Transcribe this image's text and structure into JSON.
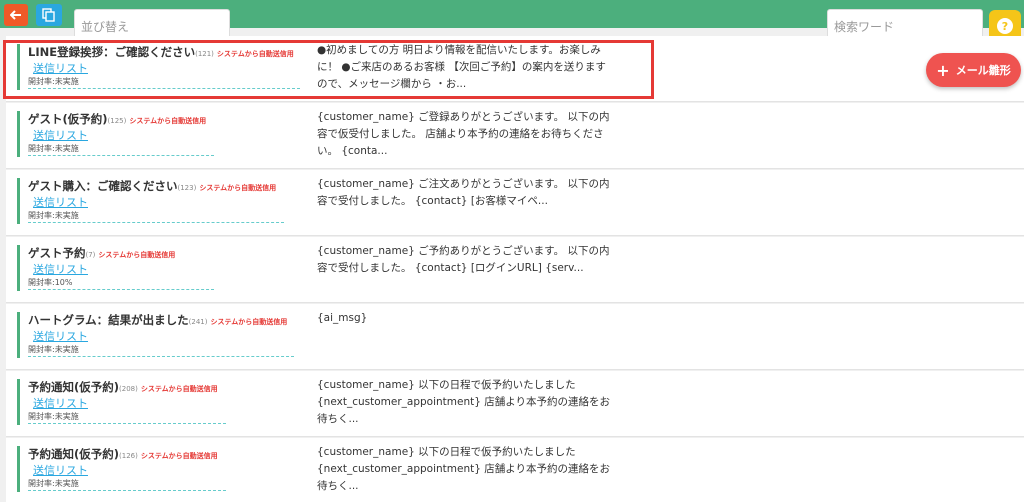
{
  "toolbar": {
    "sort_placeholder": "並び替え",
    "search_placeholder": "検索ワード",
    "new_mail_label": "メール雛形",
    "help_label": "?"
  },
  "rows": [
    {
      "title": "LINE登録挨拶：ご確認ください",
      "count": "(121)",
      "auto_label": "システムから自動送信用",
      "link": "送信リスト",
      "rate": "開封率:未実施",
      "message": "●初めましての方 明日より情報を配信いたします。お楽しみに！ ●ご来店のあるお客様 【次回ご予約】の案内を送りますので、メッセージ欄から ・お..."
    },
    {
      "title": "ゲスト(仮予約)",
      "count": "(125)",
      "auto_label": "システムから自動送信用",
      "link": "送信リスト",
      "rate": "開封率:未実施",
      "message": "{customer_name} ご登録ありがとうございます。 以下の内容で仮受付しました。 店舗より本予約の連絡をお待ちください。 {conta..."
    },
    {
      "title": "ゲスト購入：ご確認ください",
      "count": "(123)",
      "auto_label": "システムから自動送信用",
      "link": "送信リスト",
      "rate": "開封率:未実施",
      "message": "{customer_name} ご注文ありがとうございます。 以下の内容で受付しました。 {contact} [お客様マイペ..."
    },
    {
      "title": "ゲスト予約",
      "count": "(7)",
      "auto_label": "システムから自動送信用",
      "link": "送信リスト",
      "rate": "開封率:10%",
      "message": "{customer_name} ご予約ありがとうございます。 以下の内容で受付しました。 {contact} [ログインURL] {serv..."
    },
    {
      "title": "ハートグラム：結果が出ました",
      "count": "(241)",
      "auto_label": "システムから自動送信用",
      "link": "送信リスト",
      "rate": "開封率:未実施",
      "message": "{ai_msg}"
    },
    {
      "title": "予約通知(仮予約)",
      "count": "(208)",
      "auto_label": "システムから自動送信用",
      "link": "送信リスト",
      "rate": "開封率:未実施",
      "message": "{customer_name} 以下の日程で仮予約いたしました {next_customer_appointment} 店舗より本予約の連絡をお待ちく..."
    },
    {
      "title": "予約通知(仮予約)",
      "count": "(126)",
      "auto_label": "システムから自動送信用",
      "link": "送信リスト",
      "rate": "開封率:未実施",
      "message": "{customer_name} 以下の日程で仮予約いたしました {next_customer_appointment} 店舗より本予約の連絡をお待ちく..."
    }
  ],
  "colors": {
    "header": "#4caf7d",
    "back": "#f05a28",
    "copy": "#2aa7e0",
    "help": "#f5c518",
    "new_button": "#ef5350",
    "highlight": "#e53935"
  }
}
